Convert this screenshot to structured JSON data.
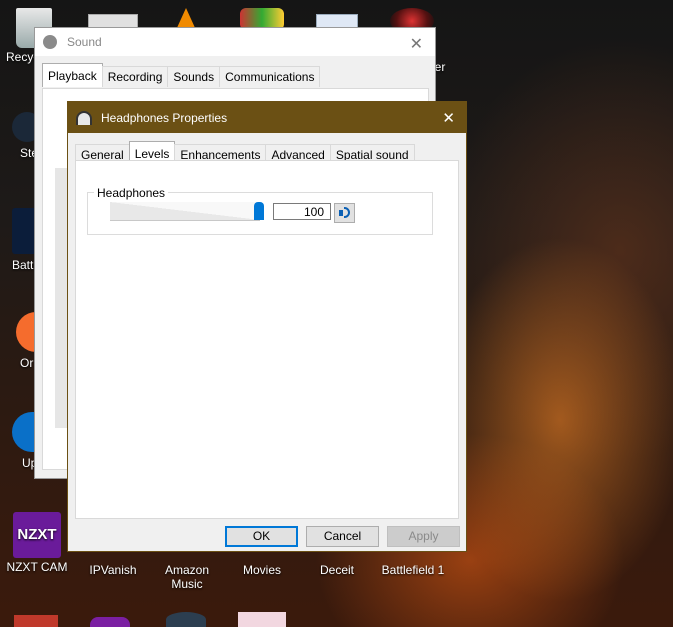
{
  "desktop": {
    "icons_partial": [
      "Recyc",
      "Ste",
      "Batt",
      "Or",
      "Up"
    ],
    "top_right_partial": "ger",
    "bottom_icons": [
      "NZXT CAM",
      "IPVanish",
      "Amazon Music",
      "Movies",
      "Deceit",
      "Battlefield 1"
    ],
    "nzxt_logo_text": "NZXT"
  },
  "sound_window": {
    "title": "Sound",
    "tabs": [
      "Playback",
      "Recording",
      "Sounds",
      "Communications"
    ],
    "selected_tab": 0
  },
  "headphones_window": {
    "title": "Headphones Properties",
    "title_bar_color": "#6b5014",
    "tabs": [
      "General",
      "Levels",
      "Enhancements",
      "Advanced",
      "Spatial sound"
    ],
    "selected_tab": 1,
    "group_label": "Headphones",
    "volume_value": "100",
    "volume_level": 1.0,
    "buttons": {
      "ok": "OK",
      "cancel": "Cancel",
      "apply": "Apply"
    }
  }
}
